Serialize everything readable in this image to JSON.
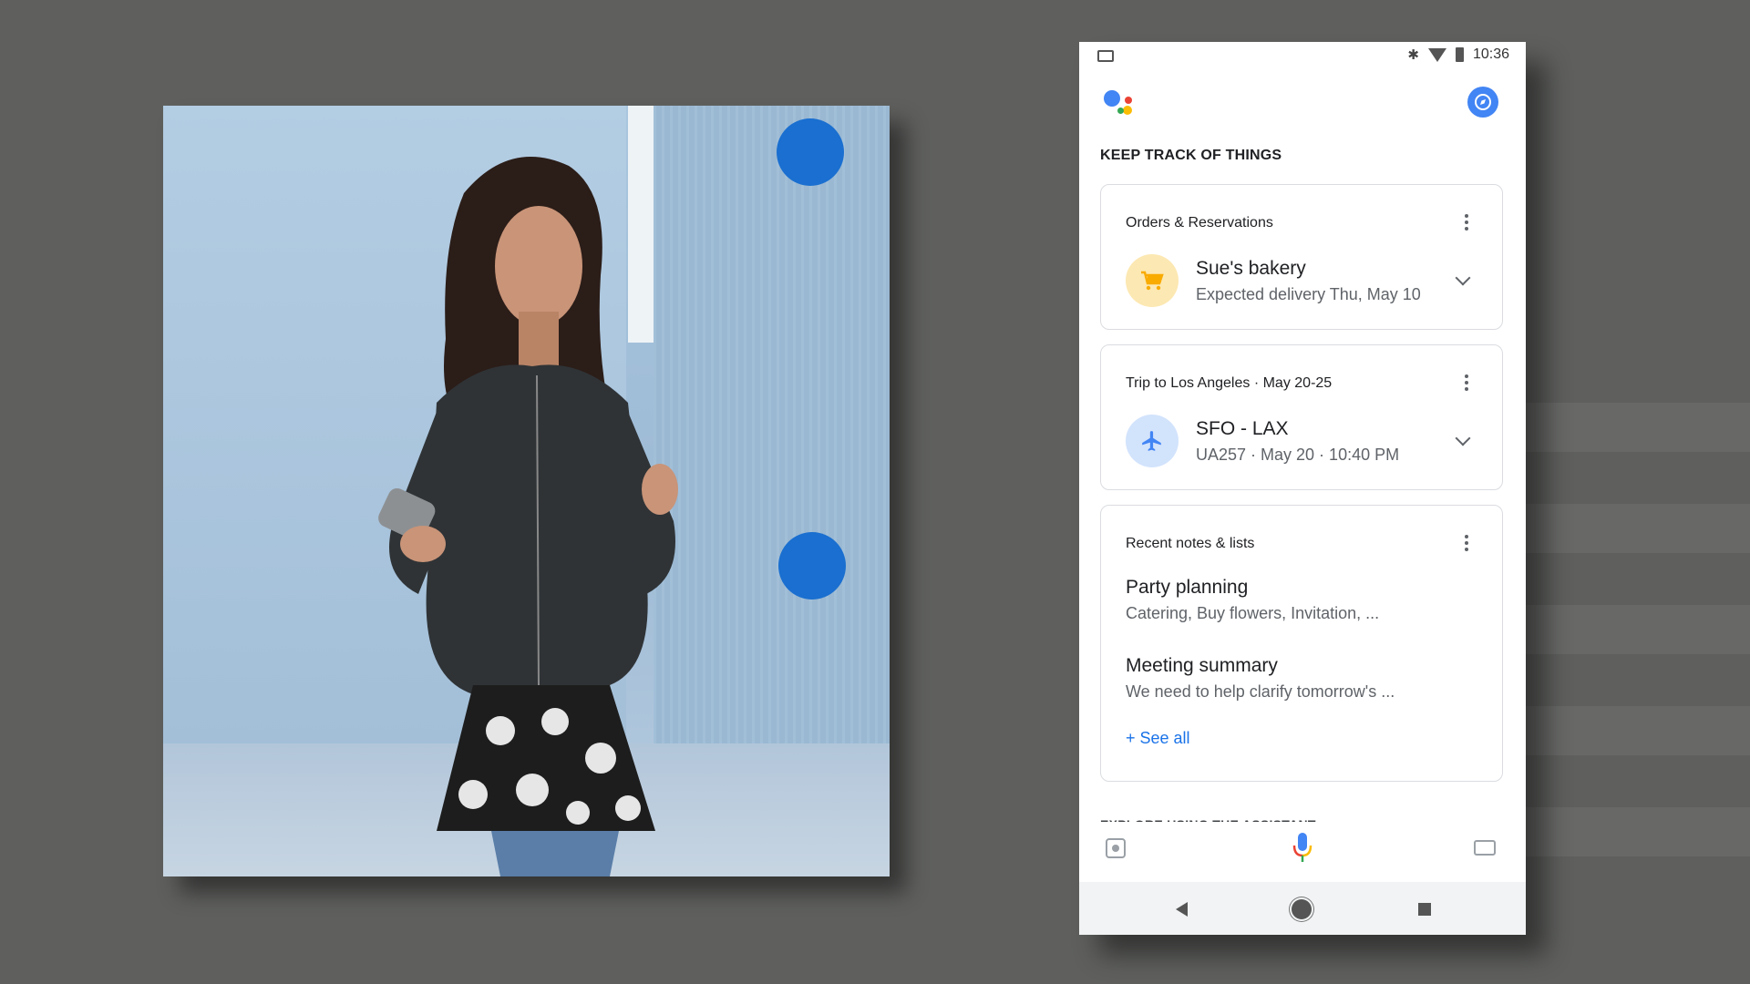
{
  "phone": {
    "status_bar": {
      "time": "10:36",
      "icons": [
        "cast-icon",
        "bluetooth-icon",
        "wifi-icon",
        "battery-icon"
      ]
    },
    "header": {
      "logo": "google-assistant-logo",
      "explore_icon": "compass-icon"
    },
    "section_title": "KEEP TRACK OF THINGS",
    "cards": [
      {
        "title": "Orders & Reservations",
        "item": {
          "icon": "cart-icon",
          "icon_bg": "#fce8b2",
          "icon_color": "#f9ab00",
          "title": "Sue's bakery",
          "subtitle": "Expected delivery Thu, May 10"
        }
      },
      {
        "title": "Trip to Los Angeles · May 20-25",
        "item": {
          "icon": "airplane-icon",
          "icon_bg": "#d2e3fc",
          "icon_color": "#4285f4",
          "title": "SFO - LAX",
          "subtitle": "UA257 · May 20 · 10:40 PM"
        }
      },
      {
        "title": "Recent notes & lists",
        "notes": [
          {
            "title": "Party planning",
            "subtitle": "Catering, Buy flowers, Invitation, ..."
          },
          {
            "title": "Meeting summary",
            "subtitle": "We need to help clarify tomorrow's ..."
          }
        ],
        "see_all": "+ See all"
      }
    ],
    "next_section_cutoff": "EXPLORE USING THE ASSISTANT",
    "bottom_bar": {
      "left": "lens-icon",
      "center": "mic-icon",
      "right": "keyboard-icon"
    },
    "nav_bar": [
      "back-icon",
      "home-icon",
      "recents-icon"
    ]
  },
  "colors": {
    "background": "#5f605e",
    "accent_blue": "#1a73e8",
    "stage_dot": "#1a6fd0"
  }
}
